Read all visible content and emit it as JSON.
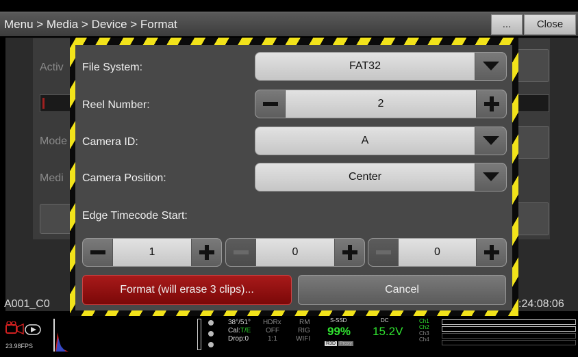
{
  "header": {
    "breadcrumb": "Menu > Media > Device > Format",
    "more_label": "...",
    "close_label": "Close"
  },
  "background": {
    "labels": [
      "Activ",
      "Mode",
      "Medi"
    ],
    "clip_name": "A001_C0",
    "timecode": ":24:08:06"
  },
  "dialog": {
    "file_system": {
      "label": "File System:",
      "value": "FAT32"
    },
    "reel_number": {
      "label": "Reel Number:",
      "value": "2"
    },
    "camera_id": {
      "label": "Camera ID:",
      "value": "A"
    },
    "camera_position": {
      "label": "Camera Position:",
      "value": "Center"
    },
    "edge_timecode": {
      "label": "Edge Timecode Start:",
      "values": [
        "1",
        "0",
        "0"
      ]
    },
    "format_button": "Format (will erase 3 clips)...",
    "cancel_button": "Cancel"
  },
  "statusbar": {
    "fps": "23.98FPS",
    "temp": "38°/51°",
    "cal_label": "Cal:",
    "cal_value": "T/E",
    "drop": "Drop:0",
    "hdrx": "HDRx",
    "off": "OFF",
    "ratio": "1:1",
    "rm": "RM",
    "rig": "RIG",
    "wifi": "WIFI",
    "media_label": "S-SSD",
    "media_pct": "99%",
    "media_badges": [
      "R3D",
      "Proxy"
    ],
    "power_label": "DC",
    "power_value": "15.2V",
    "channels": [
      "Ch1",
      "Ch2",
      "Ch3",
      "Ch4"
    ],
    "colors": {
      "green": "#2fe02f",
      "record_red": "#d02020",
      "hazard_yellow": "#f2e31a"
    }
  }
}
